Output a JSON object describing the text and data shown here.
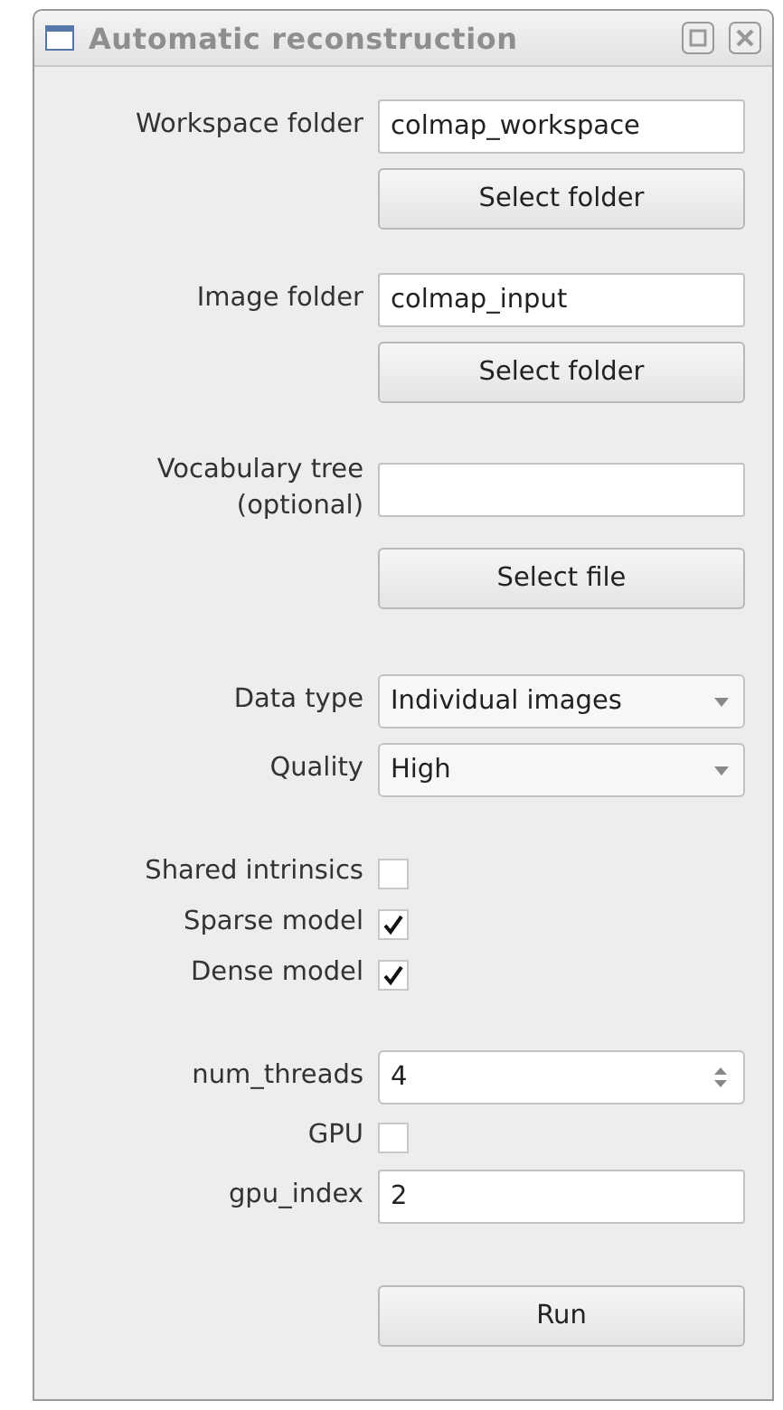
{
  "window": {
    "title": "Automatic reconstruction"
  },
  "groups": [
    {
      "rows": [
        {
          "kind": "field",
          "label": "Workspace folder",
          "value": "colmap_workspace"
        },
        {
          "kind": "button",
          "text": "Select folder"
        }
      ]
    },
    {
      "rows": [
        {
          "kind": "field",
          "label": "Image folder",
          "value": "colmap_input"
        },
        {
          "kind": "button",
          "text": "Select folder"
        }
      ]
    },
    {
      "rows": [
        {
          "kind": "field",
          "label": "Vocabulary tree (optional)",
          "value": ""
        },
        {
          "kind": "button",
          "text": "Select file"
        }
      ]
    },
    {
      "rows": [
        {
          "kind": "combo",
          "label": "Data type",
          "value": "Individual images"
        },
        {
          "kind": "combo",
          "label": "Quality",
          "value": "High"
        }
      ]
    },
    {
      "rows": [
        {
          "kind": "checkbox",
          "label": "Shared intrinsics",
          "checked": false
        },
        {
          "kind": "checkbox",
          "label": "Sparse model",
          "checked": true
        },
        {
          "kind": "checkbox",
          "label": "Dense model",
          "checked": true
        }
      ]
    },
    {
      "rows": [
        {
          "kind": "spin",
          "label": "num_threads",
          "value": "4"
        },
        {
          "kind": "checkbox",
          "label": "GPU",
          "checked": false
        },
        {
          "kind": "field",
          "label": "gpu_index",
          "value": "2"
        }
      ]
    },
    {
      "rows": [
        {
          "kind": "button",
          "text": "Run"
        }
      ]
    }
  ]
}
